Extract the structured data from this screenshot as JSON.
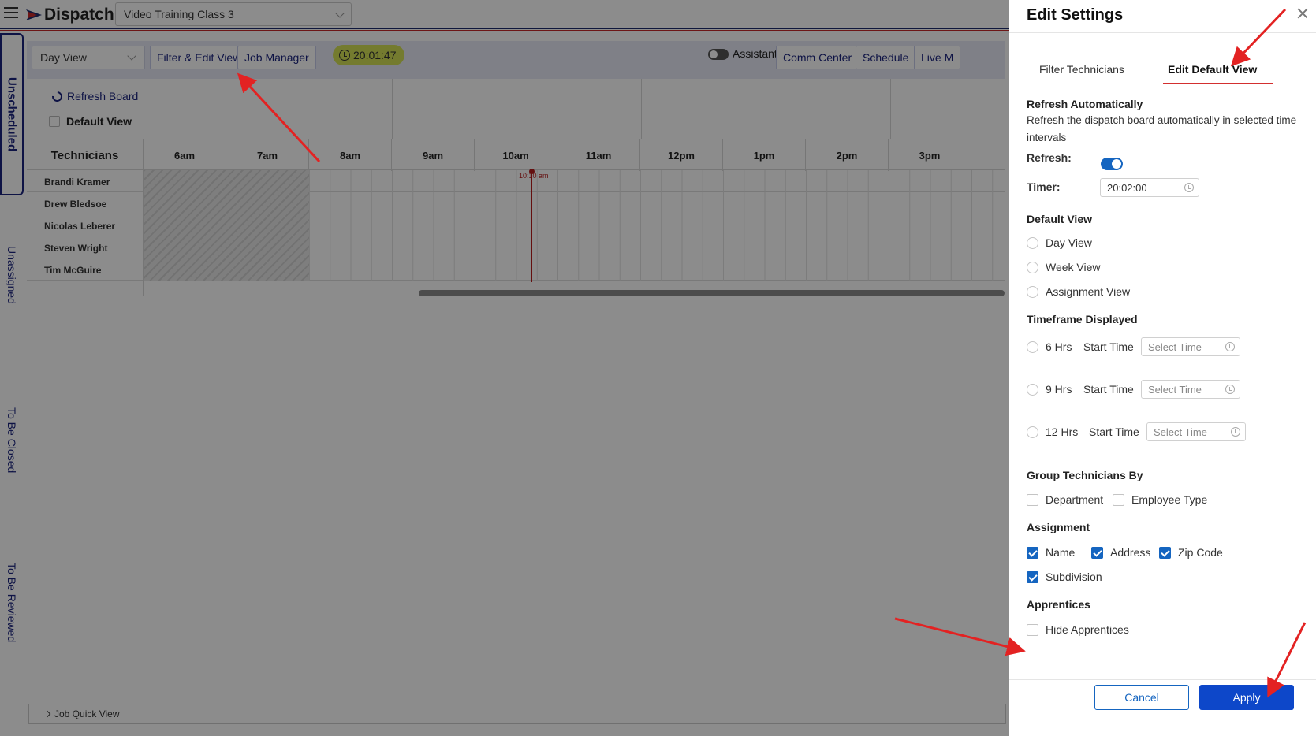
{
  "app": {
    "brand": "Dispatch",
    "class_select": "Video Training Class 3"
  },
  "side_tabs": [
    "Unscheduled",
    "Unassigned",
    "To Be Closed",
    "To Be Reviewed"
  ],
  "toolbar": {
    "view_select": "Day View",
    "filter_edit_view": "Filter & Edit View",
    "job_manager": "Job Manager",
    "clock": "20:01:47",
    "assistant_label": "Assistant",
    "comm_center": "Comm Center",
    "schedule": "Schedule",
    "live": "Live M"
  },
  "board": {
    "refresh_board": "Refresh Board",
    "default_view": "Default View",
    "technicians_header": "Technicians",
    "hours": [
      "6am",
      "7am",
      "8am",
      "9am",
      "10am",
      "11am",
      "12pm",
      "1pm",
      "2pm",
      "3pm"
    ],
    "technicians": [
      "Brandi Kramer",
      "Drew Bledsoe",
      "Nicolas Leberer",
      "Steven Wright",
      "Tim McGuire"
    ],
    "now_label": "10:10 am",
    "job_quick_view": "Job Quick View"
  },
  "settings": {
    "title": "Edit Settings",
    "tabs": [
      "Filter Technicians",
      "Edit Default View"
    ],
    "active_tab": "Edit Default View",
    "refresh_auto_title": "Refresh Automatically",
    "refresh_auto_desc": "Refresh the dispatch board automatically in selected time intervals",
    "refresh_label": "Refresh:",
    "refresh_on": true,
    "timer_label": "Timer:",
    "timer_value": "20:02:00",
    "default_view_title": "Default View",
    "default_view_options": [
      "Day View",
      "Week View",
      "Assignment View"
    ],
    "timeframe_title": "Timeframe Displayed",
    "timeframes": [
      {
        "label": "6 Hrs",
        "start": "Start Time",
        "placeholder": "Select Time"
      },
      {
        "label": "9 Hrs",
        "start": "Start Time",
        "placeholder": "Select Time"
      },
      {
        "label": "12 Hrs",
        "start": "Start Time",
        "placeholder": "Select Time"
      }
    ],
    "group_title": "Group Technicians By",
    "group_options": [
      "Department",
      "Employee Type"
    ],
    "assignment_title": "Assignment",
    "assignment_options": [
      "Name",
      "Address",
      "Zip Code",
      "Subdivision"
    ],
    "apprentices_title": "Apprentices",
    "hide_apprentices": "Hide Apprentices",
    "cancel": "Cancel",
    "apply": "Apply"
  },
  "colors": {
    "primary": "#1565c0",
    "navy": "#1a237e",
    "clock_bg": "#d4e157",
    "arrow": "#e32222"
  }
}
